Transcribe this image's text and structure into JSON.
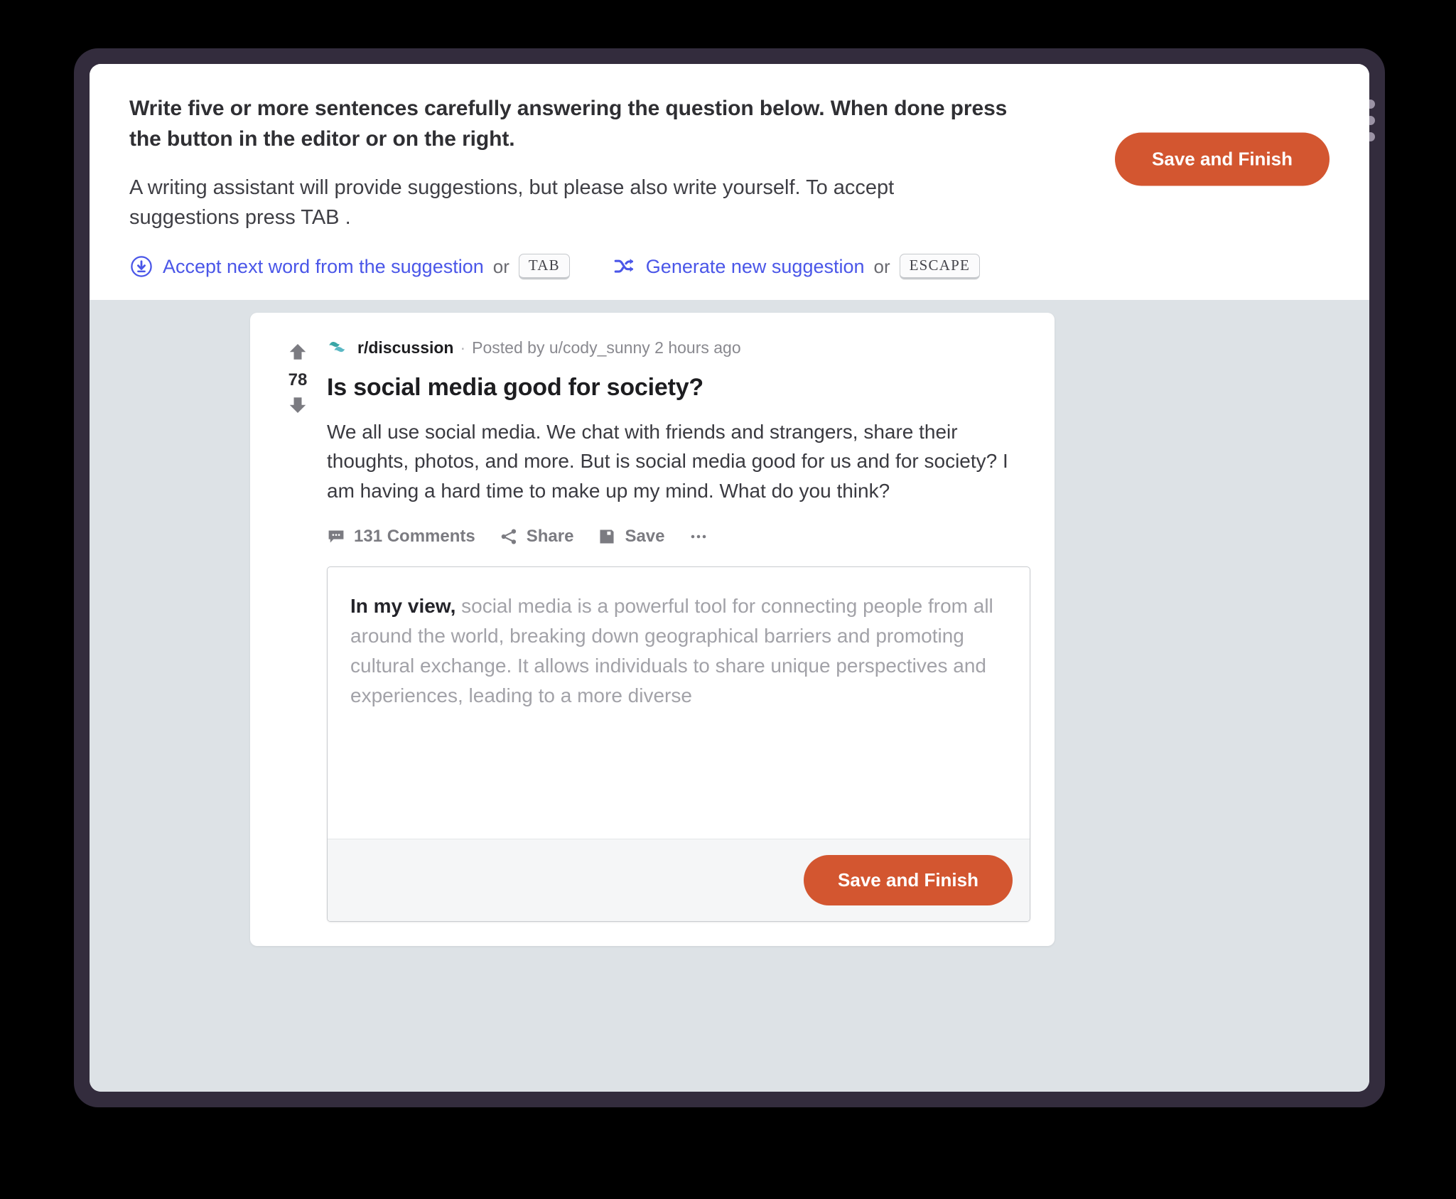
{
  "window": {
    "frame_color": "#332c3d",
    "page_background": "#dde2e6",
    "dots": [
      "dot",
      "dot",
      "dot"
    ]
  },
  "instructions": {
    "heading": "Write five or more sentences carefully answering the question below. When done press the button in the editor or on the right.",
    "subtext": "A writing assistant will provide suggestions, but please also write yourself. To accept suggestions press TAB .",
    "hints": [
      {
        "icon": "download-circle-icon",
        "label": "Accept next word from the suggestion",
        "or": "or",
        "key": "TAB"
      },
      {
        "icon": "shuffle-icon",
        "label": "Generate new suggestion",
        "or": "or",
        "key": "ESCAPE"
      }
    ],
    "accent_color": "#4a56e8"
  },
  "header": {
    "save_label": "Save and Finish",
    "save_color": "#d35630"
  },
  "post": {
    "votes": "78",
    "upvote_icon": "arrow-up-icon",
    "downvote_icon": "arrow-down-icon",
    "avatar_icon": "subreddit-avatar-icon",
    "subreddit": "r/discussion",
    "meta_separator": "·",
    "meta": "Posted by u/cody_sunny 2 hours ago",
    "title": "Is social media good for society?",
    "body": "We all use social media. We chat with friends and strangers, share their thoughts, photos, and more. But is social media good for us and for society? I am having a hard time to make up my mind. What do you think?",
    "actions": [
      {
        "icon": "comment-icon",
        "label": "131 Comments"
      },
      {
        "icon": "share-icon",
        "label": "Share"
      },
      {
        "icon": "floppy-save-icon",
        "label": "Save"
      },
      {
        "icon": "more-options-icon",
        "label": ""
      }
    ]
  },
  "editor": {
    "typed_text": "In my view,",
    "suggestion_text": " social media is a powerful tool for connecting people from all around the world, breaking down geographical barriers and promoting cultural exchange. It allows individuals to share unique perspectives and experiences, leading to a more diverse",
    "save_label": "Save and Finish"
  }
}
